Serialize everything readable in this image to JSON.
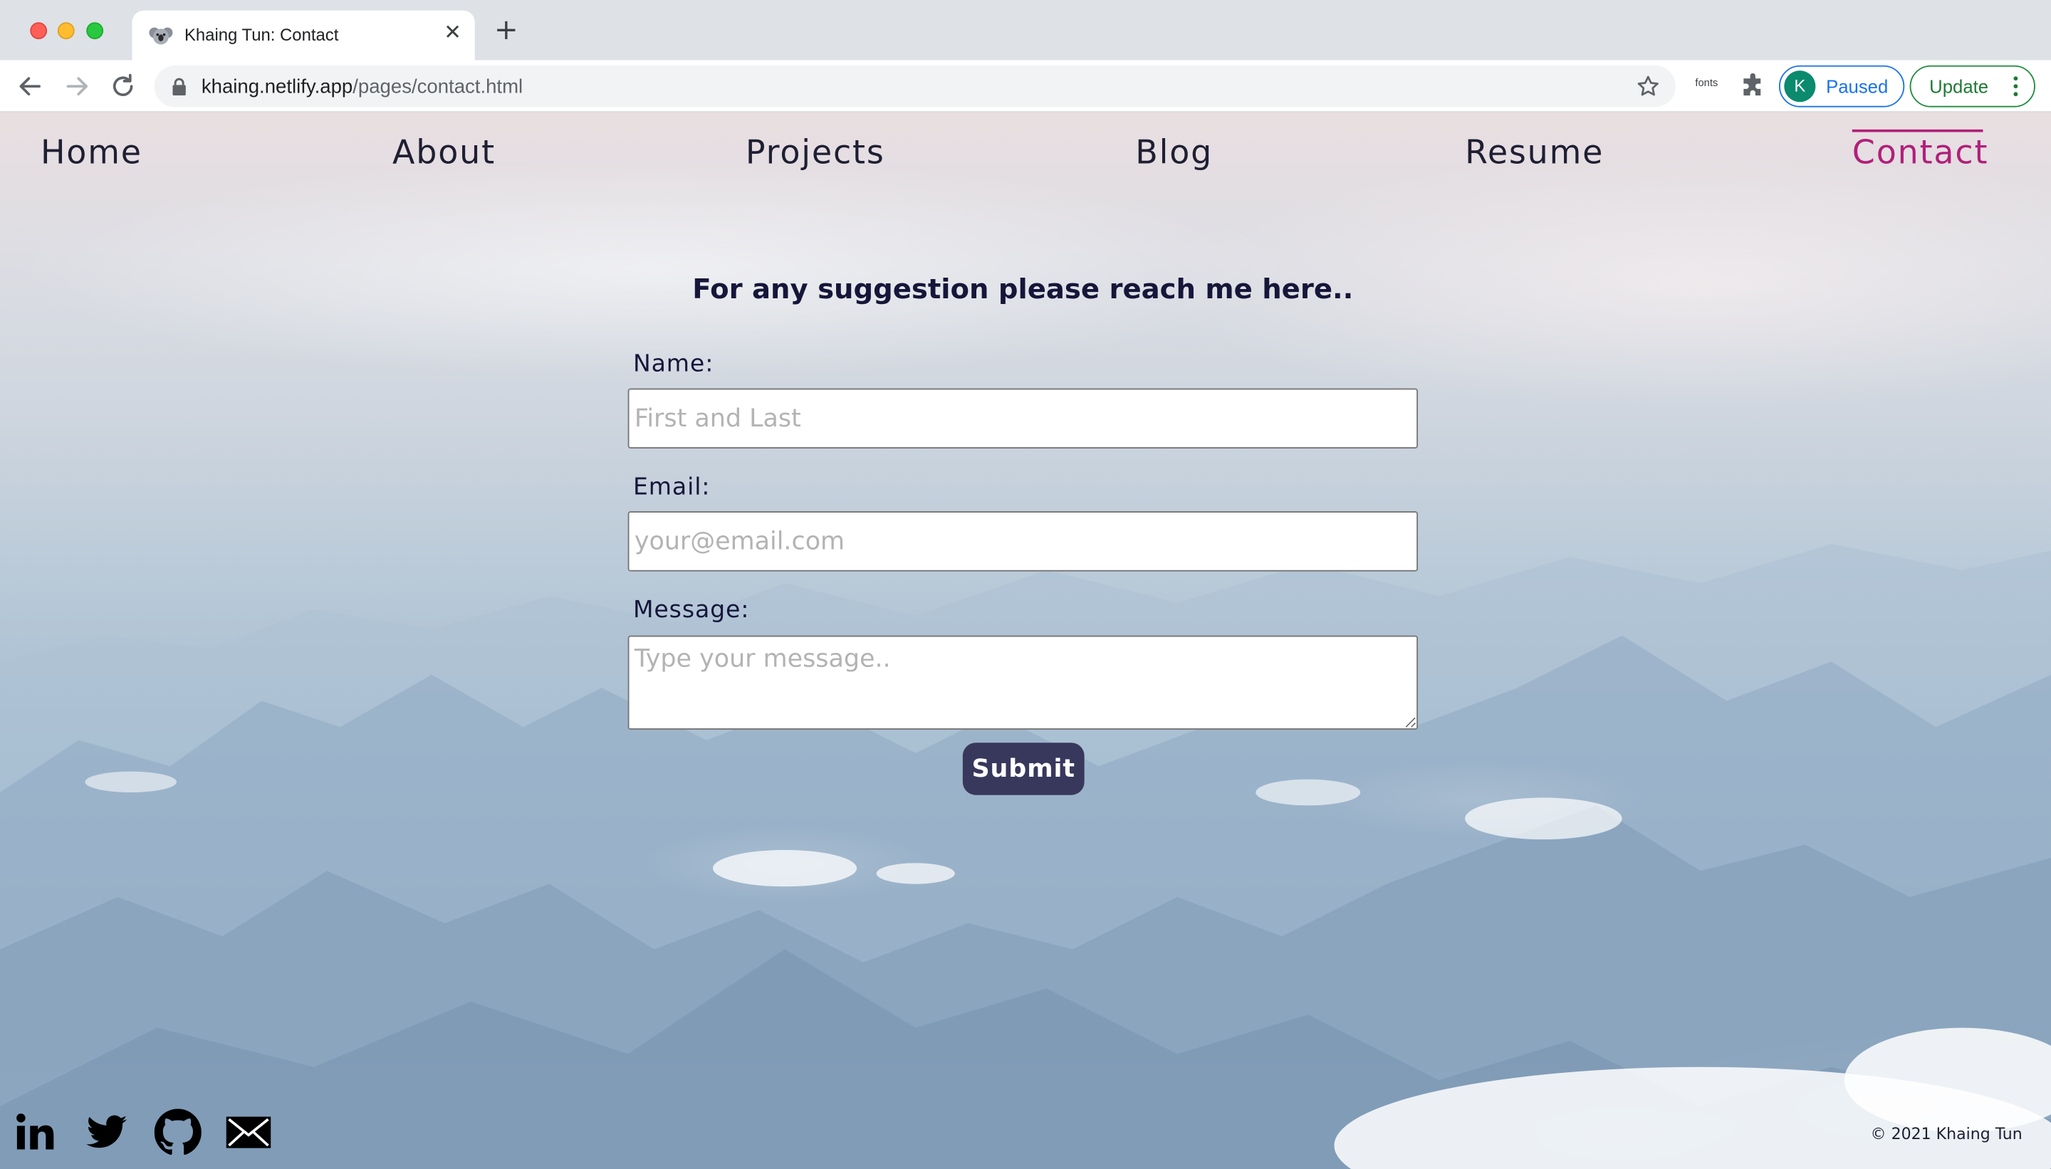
{
  "browser": {
    "tab_title": "Khaing Tun: Contact",
    "url_domain": "khaing.netlify.app",
    "url_path": "/pages/contact.html",
    "extension_label": "fonts",
    "profile_initial": "K",
    "profile_status": "Paused",
    "update_label": "Update"
  },
  "nav": {
    "items": [
      {
        "label": "Home"
      },
      {
        "label": "About"
      },
      {
        "label": "Projects"
      },
      {
        "label": "Blog"
      },
      {
        "label": "Resume"
      },
      {
        "label": "Contact",
        "active": true
      }
    ],
    "active_color": "#b0207a"
  },
  "contact": {
    "heading": "For any suggestion please reach me here..",
    "name_label": "Name:",
    "name_placeholder": "First and Last",
    "email_label": "Email:",
    "email_placeholder": "your@email.com",
    "message_label": "Message:",
    "message_placeholder": "Type your message..",
    "submit_label": "Submit",
    "submit_color": "#38385d"
  },
  "footer": {
    "social_icons": [
      "linkedin-icon",
      "twitter-icon",
      "github-icon",
      "email-icon"
    ],
    "copyright": "© 2021 Khaing Tun"
  }
}
